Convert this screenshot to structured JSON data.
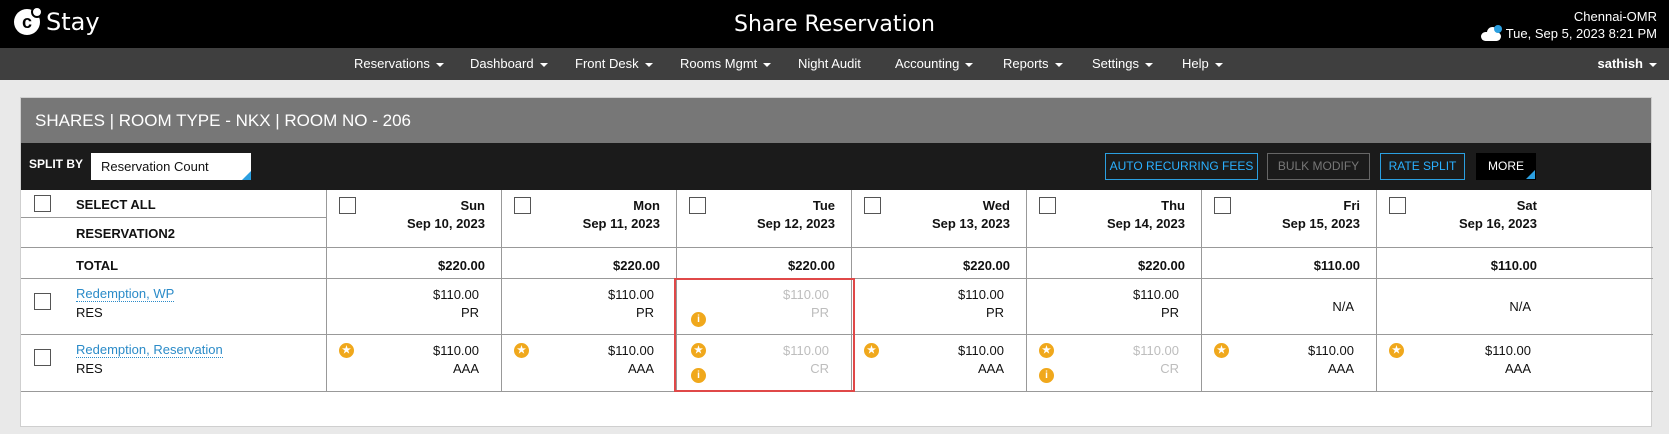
{
  "app": {
    "logo_letter": "c",
    "logo_text": "Stay",
    "title": "Share Reservation"
  },
  "hotel": {
    "name": "Chennai-OMR",
    "datetime": "Tue, Sep 5, 2023 8:21 PM"
  },
  "nav": {
    "items": [
      "Reservations",
      "Dashboard",
      "Front Desk",
      "Rooms Mgmt",
      "Night Audit",
      "Accounting",
      "Reports",
      "Settings",
      "Help"
    ],
    "user": "sathish"
  },
  "panel": {
    "header": "SHARES | ROOM TYPE - NKX | ROOM NO - 206"
  },
  "toolbar": {
    "split_label": "SPLIT BY",
    "split_value": "Reservation Count",
    "auto_recurring": "AUTO RECURRING FEES",
    "bulk_modify": "BULK MODIFY",
    "rate_split": "RATE SPLIT",
    "more": "MORE"
  },
  "grid": {
    "select_all": "SELECT ALL",
    "reservation_name": "RESERVATION2",
    "total_label": "TOTAL",
    "days": [
      {
        "name": "Sun",
        "date": "Sep 10, 2023",
        "total": "$220.00"
      },
      {
        "name": "Mon",
        "date": "Sep 11, 2023",
        "total": "$220.00"
      },
      {
        "name": "Tue",
        "date": "Sep 12, 2023",
        "total": "$220.00"
      },
      {
        "name": "Wed",
        "date": "Sep 13, 2023",
        "total": "$220.00"
      },
      {
        "name": "Thu",
        "date": "Sep 14, 2023",
        "total": "$220.00"
      },
      {
        "name": "Fri",
        "date": "Sep 15, 2023",
        "total": "$110.00"
      },
      {
        "name": "Sat",
        "date": "Sep 16, 2023",
        "total": "$110.00"
      }
    ],
    "guests": [
      {
        "name": "Redemption, WP",
        "type": "RES",
        "cells": [
          {
            "amount": "$110.00",
            "code": "PR"
          },
          {
            "amount": "$110.00",
            "code": "PR"
          },
          {
            "amount": "$110.00",
            "code": "PR",
            "muted": true,
            "info": true
          },
          {
            "amount": "$110.00",
            "code": "PR"
          },
          {
            "amount": "$110.00",
            "code": "PR"
          },
          {
            "na": "N/A"
          },
          {
            "na": "N/A"
          }
        ]
      },
      {
        "name": "Redemption, Reservation",
        "type": "RES",
        "cells": [
          {
            "amount": "$110.00",
            "code": "AAA",
            "star": true
          },
          {
            "amount": "$110.00",
            "code": "AAA",
            "star": true
          },
          {
            "amount": "$110.00",
            "code": "CR",
            "muted": true,
            "star": true,
            "info": true
          },
          {
            "amount": "$110.00",
            "code": "AAA",
            "star": true
          },
          {
            "amount": "$110.00",
            "code": "CR",
            "muted": true,
            "star": true,
            "info": true
          },
          {
            "amount": "$110.00",
            "code": "AAA",
            "star": true
          },
          {
            "amount": "$110.00",
            "code": "AAA",
            "star": true
          }
        ]
      }
    ]
  },
  "icons": {
    "star": "star-icon",
    "info": "info-icon",
    "weather": "cloud-icon"
  },
  "colors": {
    "accent": "#2b9fe0",
    "icon_orange": "#f0a81c",
    "highlight": "#e04848"
  }
}
